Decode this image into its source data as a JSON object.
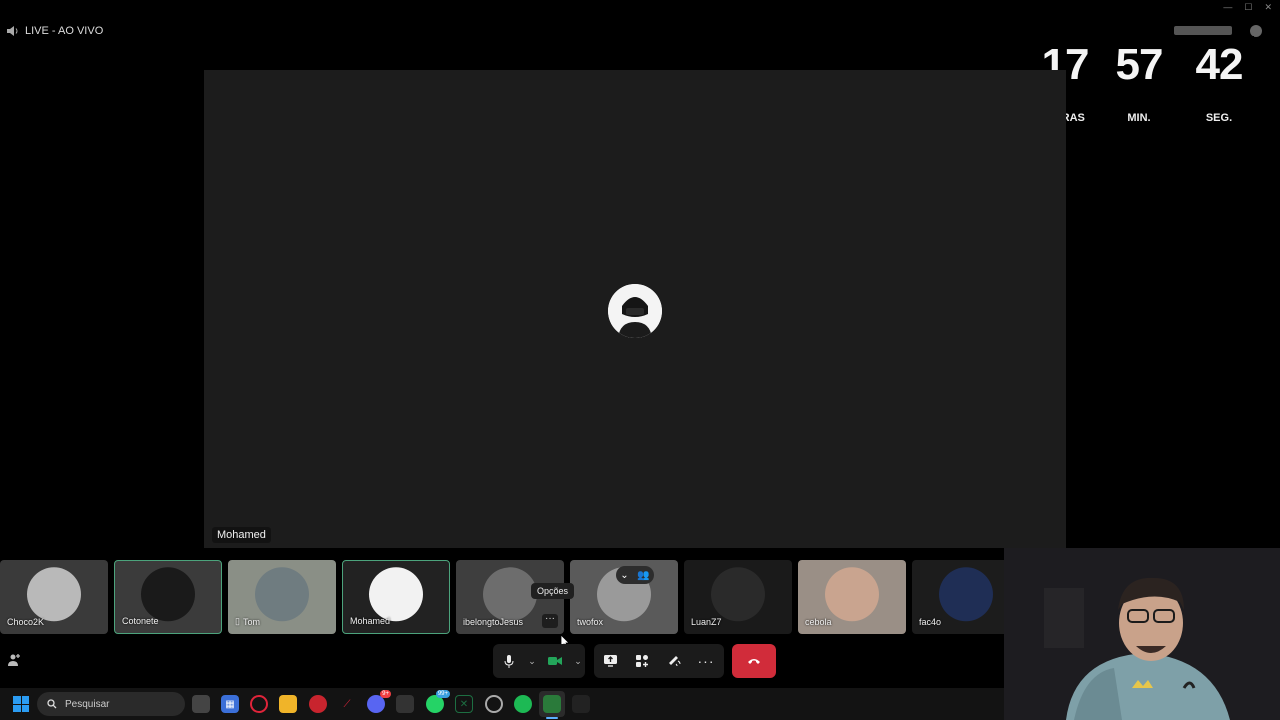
{
  "live_label": "LIVE - AO VIVO",
  "countdown": {
    "hours": "17",
    "hours_label": "HORAS",
    "minutes": "57",
    "minutes_label": "MIN.",
    "seconds": "42",
    "seconds_label": "SEG."
  },
  "stage": {
    "speaker_name": "Mohamed"
  },
  "participants": [
    {
      "name": "Choco2K",
      "bg": "#3a3a3a",
      "art": "#b9b9b9",
      "active": false,
      "phone": false
    },
    {
      "name": "Cotonete",
      "bg": "#3b3b3b",
      "art": "#1a1a1a",
      "active": true,
      "phone": false
    },
    {
      "name": "Tom",
      "bg": "#8a8f86",
      "art": "#6f7c80",
      "active": false,
      "phone": true
    },
    {
      "name": "Mohamed",
      "bg": "#222222",
      "art": "#f2f2f2",
      "active": true,
      "phone": false
    },
    {
      "name": "ibelongtoJesus",
      "bg": "#3e3e3e",
      "art": "#6d6d6d",
      "active": false,
      "phone": false
    },
    {
      "name": "twofox",
      "bg": "#5a5a5a",
      "art": "#9a9a9a",
      "active": false,
      "phone": false
    },
    {
      "name": "LuanZ7",
      "bg": "#1a1a1a",
      "art": "#2a2a2a",
      "active": false,
      "phone": false
    },
    {
      "name": "cebola",
      "bg": "#9a8f86",
      "art": "#c9a48f",
      "active": false,
      "phone": false
    },
    {
      "name": "fac4o",
      "bg": "#1c1c1c",
      "art": "#1f2e55",
      "active": false,
      "phone": false
    }
  ],
  "tooltip": "Opções",
  "taskbar": {
    "search_placeholder": "Pesquisar",
    "whatsapp_badge": "99+",
    "discord_badge": "9+"
  },
  "colors": {
    "leave": "#d12c3a",
    "active_border": "#4ca37c",
    "accent": "#23a55a"
  }
}
